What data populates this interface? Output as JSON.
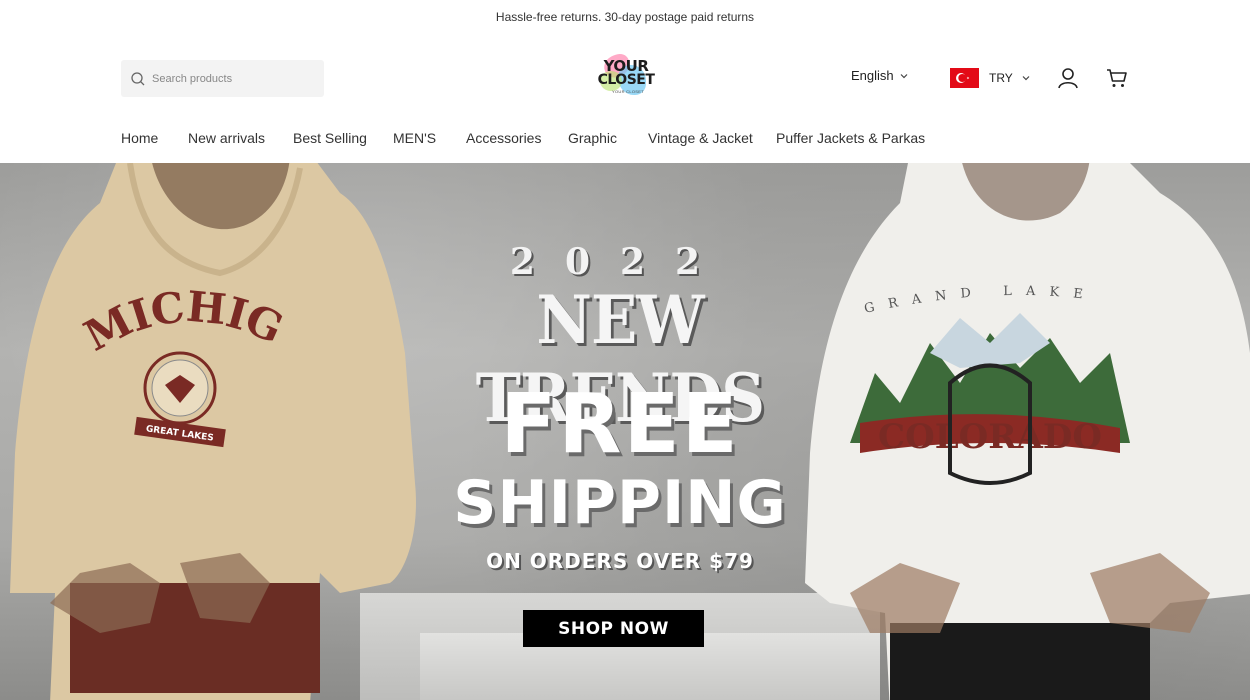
{
  "announcement": {
    "text": "Hassle-free returns. 30-day postage paid returns"
  },
  "header": {
    "search_placeholder": "Search products",
    "logo_line1": "YOUR",
    "logo_line2": "CLOSET",
    "logo_line3": "YOUR CLOSET",
    "language": "English",
    "currency": "TRY",
    "icons": {
      "search": "search-icon",
      "user": "user-icon",
      "cart": "cart-icon",
      "chevron": "chevron-down-icon",
      "flag": "turkey-flag-icon"
    }
  },
  "nav": {
    "items": [
      {
        "label": "Home"
      },
      {
        "label": "New arrivals"
      },
      {
        "label": "Best Selling"
      },
      {
        "label": "MEN'S"
      },
      {
        "label": "Accessories"
      },
      {
        "label": "Graphic"
      },
      {
        "label": "Vintage & Jacket"
      },
      {
        "label": "Puffer Jackets & Parkas"
      }
    ]
  },
  "hero": {
    "year": "2022",
    "headline": "NEW TRENDS",
    "free": "FREE",
    "shipping": "SHIPPING",
    "subline": "ON ORDERS OVER $79",
    "cta": "SHOP NOW",
    "left_print_title": "MICHIGAN",
    "left_print_badge": "GREAT LAKES",
    "right_print_arc": "GRAND LAKE",
    "right_print_title": "COLORADO"
  },
  "colors": {
    "flag_red": "#e30a17",
    "hoodie_beige": "#dcc8a3",
    "print_maroon": "#7a2a24",
    "cta_black": "#000000"
  }
}
